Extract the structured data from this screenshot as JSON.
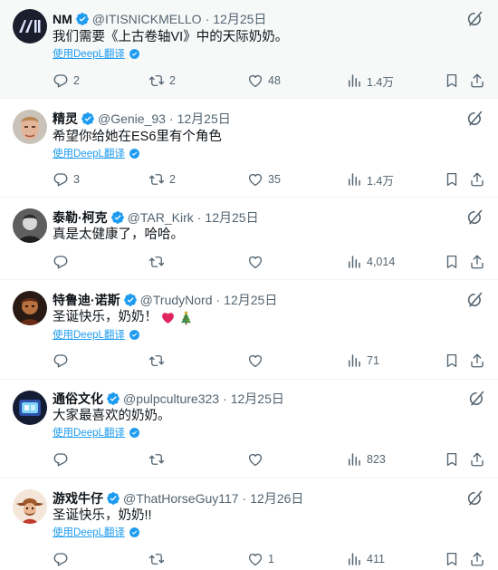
{
  "colors": {
    "accent": "#1d9bf0",
    "text": "#0f1419",
    "muted": "#536471",
    "heart": "#e0245e"
  },
  "tweets": [
    {
      "name": "NM",
      "handle": "@ITISNICKMELLO",
      "date": "12月25日",
      "text": "我们需要《上古卷轴VI》中的天际奶奶。",
      "translate": "使用DeepL翻译",
      "replies": "2",
      "retweets": "2",
      "likes": "48",
      "views": "1.4万"
    },
    {
      "name": "精灵",
      "handle": "@Genie_93",
      "date": "12月25日",
      "text": "希望你给她在ES6里有个角色",
      "translate": "使用DeepL翻译",
      "replies": "3",
      "retweets": "2",
      "likes": "35",
      "views": "1.4万"
    },
    {
      "name": "泰勒·柯克",
      "handle": "@TAR_Kirk",
      "date": "12月25日",
      "text": "真是太健康了，哈哈。",
      "translate": "",
      "replies": "",
      "retweets": "",
      "likes": "",
      "views": "4,014"
    },
    {
      "name": "特鲁迪·诺斯",
      "handle": "@TrudyNord",
      "date": "12月25日",
      "text": "圣诞快乐，奶奶！",
      "translate": "使用DeepL翻译",
      "replies": "",
      "retweets": "",
      "likes": "",
      "views": "71"
    },
    {
      "name": "通俗文化",
      "handle": "@pulpculture323",
      "date": "12月25日",
      "text": "大家最喜欢的奶奶。",
      "translate": "使用DeepL翻译",
      "replies": "",
      "retweets": "",
      "likes": "",
      "views": "823"
    },
    {
      "name": "游戏牛仔",
      "handle": "@ThatHorseGuy117",
      "date": "12月26日",
      "text": "圣诞快乐，奶奶!!",
      "translate": "使用DeepL翻译",
      "replies": "",
      "retweets": "",
      "likes": "1",
      "views": "411"
    }
  ]
}
